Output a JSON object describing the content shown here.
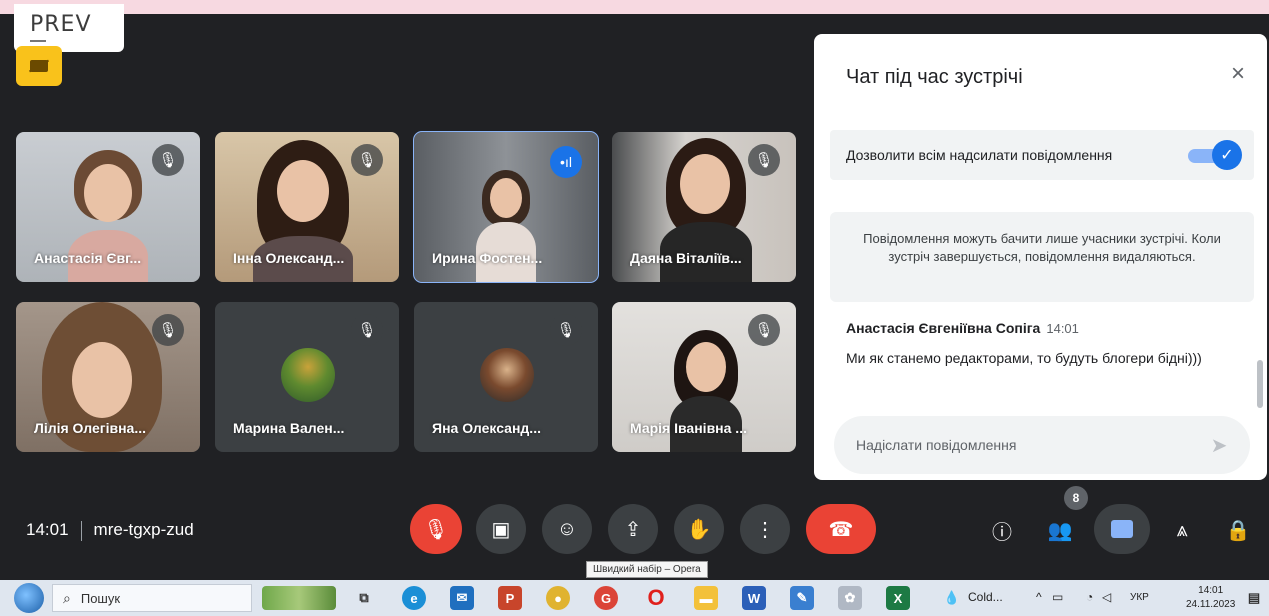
{
  "overlay": {
    "prev_label": "PREV"
  },
  "participants": [
    {
      "name": "Анастасія Євг...",
      "state": "muted"
    },
    {
      "name": "Інна Олександ...",
      "state": "muted"
    },
    {
      "name": "Ирина Фостен...",
      "state": "speaking"
    },
    {
      "name": "Даяна Віталіїв...",
      "state": "muted"
    },
    {
      "name": "Лілія Олегівна...",
      "state": "muted"
    },
    {
      "name": "Марина Вален...",
      "state": "muted"
    },
    {
      "name": "Яна Олександ...",
      "state": "muted"
    },
    {
      "name": "Марія Іванівна ...",
      "state": "muted"
    }
  ],
  "chat": {
    "title": "Чат під час зустрічі",
    "close_icon": "×",
    "toggle_label": "Дозволити всім надсилати повідомлення",
    "toggle_on": true,
    "notice": "Повідомлення можуть бачити лише учасники зустрічі. Коли зустріч завершується, повідомлення видаляються.",
    "messages": [
      {
        "sender": "Анастасія Євгеніївна Сопіга",
        "time": "14:01",
        "text": "Ми як станемо редакторами, то будуть блогери бідні)))"
      }
    ],
    "input_placeholder": "Надіслати повідомлення"
  },
  "meeting": {
    "time": "14:01",
    "code": "mre-tgxp-zud"
  },
  "controls": {
    "participants_badge": "8",
    "tooltip": "Швидкий набір – Opera"
  },
  "taskbar": {
    "search_placeholder": "Пошук",
    "app_label": "Cold...",
    "lang": "УКР",
    "clock_time": "14:01",
    "clock_date": "24.11.2023"
  },
  "colors": {
    "background": "#202124",
    "accent": "#1a73e8",
    "hangup": "#ea4335",
    "speaking_outline": "#8ab4f8"
  }
}
